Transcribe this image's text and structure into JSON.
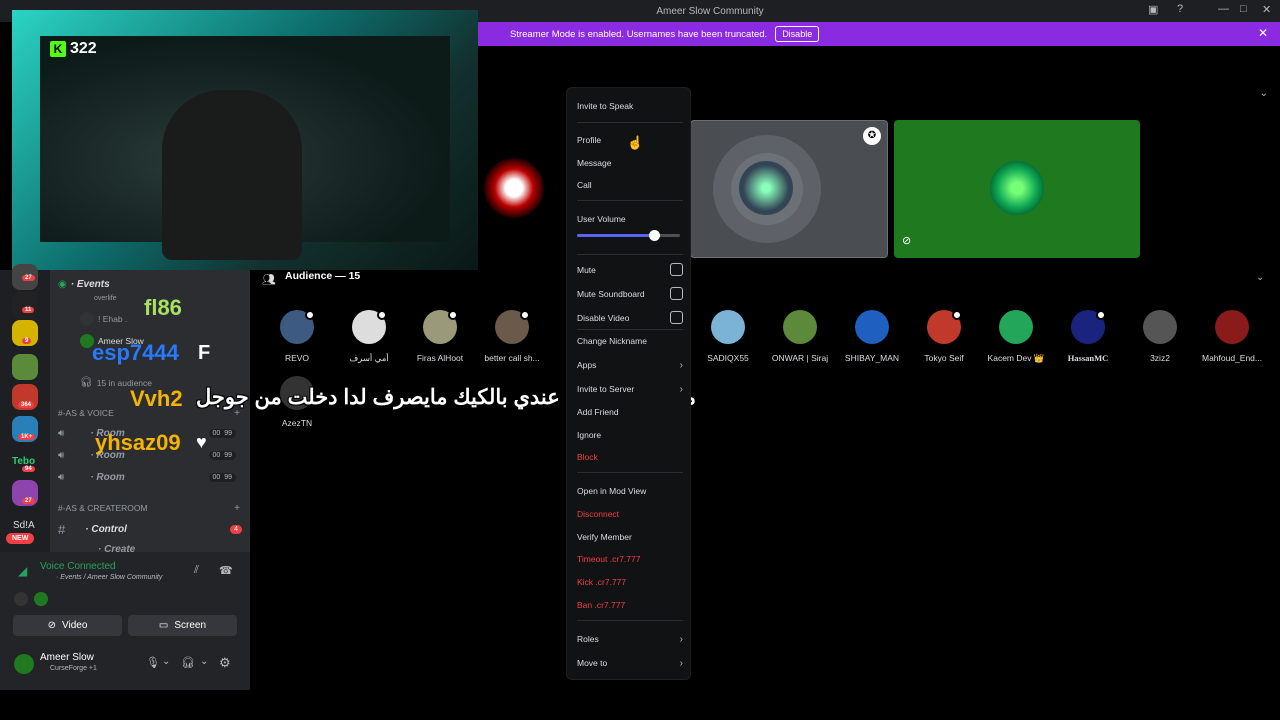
{
  "window": {
    "title": "Ameer Slow Community"
  },
  "banner": {
    "text": "Streamer Mode is enabled. Usernames have been truncated.",
    "button": "Disable"
  },
  "webcam": {
    "kick_count": "322"
  },
  "server_badges": [
    "27",
    "11",
    "9",
    "364",
    "1K+",
    "94",
    "27"
  ],
  "server_labels": {
    "tebo": "Tebo",
    "sd": "Sd!A",
    "new": "NEW"
  },
  "channels": {
    "events": "· Events",
    "events_sub": "overlife",
    "user1": "! Ehab .",
    "user2": "Ameer Slow",
    "audience_count": "15 in audience",
    "cat1": "#-AS & VOICE",
    "room1": "· Room",
    "room2": "· Room",
    "room3": "· Room",
    "room_counts": [
      "00",
      "99"
    ],
    "cat2": "#-AS & CREATEROOM",
    "control": "· Control",
    "control_badge": "4",
    "create": "· Create"
  },
  "overlay": {
    "f186": "fl86",
    "esp": "esp7444",
    "f": "F",
    "vvh2": "Vvh2",
    "yhsaz": "yhsaz09",
    "heart": "♥"
  },
  "subtitle": "مع الأسف البث عندي بالكيك مايصرف لدا دخلت من جوجل",
  "voice": {
    "status": "Voice Connected",
    "location": "· Events / Ameer Slow Community",
    "video": "Video",
    "screen": "Screen"
  },
  "user": {
    "name": "Ameer Slow",
    "activity": "CurseForge +1"
  },
  "audience": {
    "header": "Audience — 15",
    "members": [
      "REVO",
      "أمي أسرف",
      "Firas AlHoot",
      "better call sh...",
      "SADIQX55",
      "ONWAR | Siraj",
      "SHIBAY_MAN",
      "Tokyo Seif",
      "Kacem Dev 👑",
      "HassanMC",
      "3ziz2",
      "Mahfoud_End..."
    ],
    "row2": [
      "AzezTN"
    ]
  },
  "menu": {
    "invite_speak": "Invite to Speak",
    "profile": "Profile",
    "message": "Message",
    "call": "Call",
    "user_volume": "User Volume",
    "volume_level": 0.75,
    "mute": "Mute",
    "mute_soundboard": "Mute Soundboard",
    "disable_video": "Disable Video",
    "change_nickname": "Change Nickname",
    "apps": "Apps",
    "invite_server": "Invite to Server",
    "add_friend": "Add Friend",
    "ignore": "Ignore",
    "block": "Block",
    "mod_view": "Open in Mod View",
    "disconnect": "Disconnect",
    "verify": "Verify Member",
    "timeout": "Timeout .cr7.777",
    "kick": "Kick .cr7.777",
    "ban": "Ban .cr7.777",
    "roles": "Roles",
    "move_to": "Move to"
  }
}
